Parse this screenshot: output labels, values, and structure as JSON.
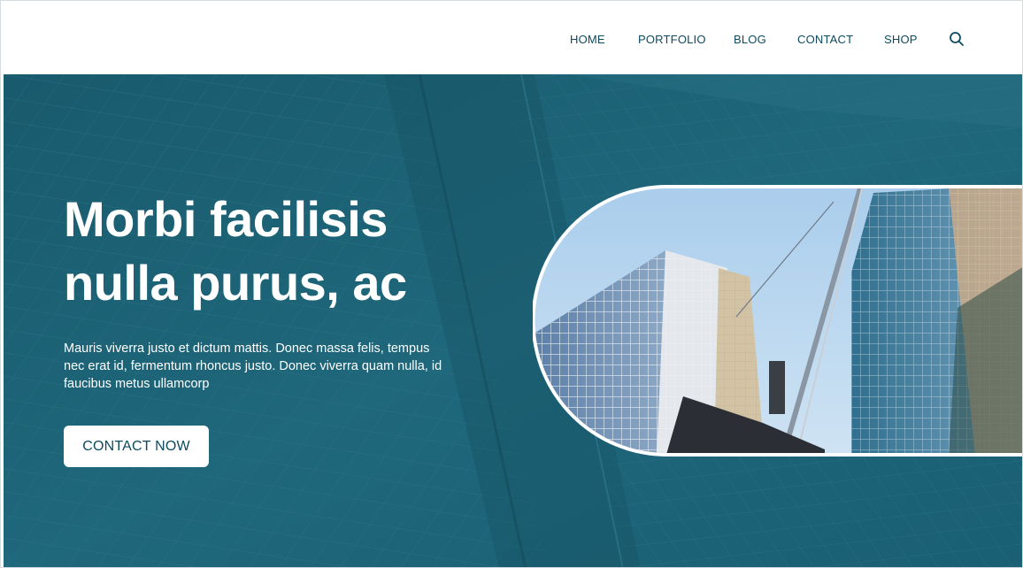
{
  "nav": {
    "items": [
      {
        "label": "HOME"
      },
      {
        "label": "PORTFOLIO"
      },
      {
        "label": "BLOG"
      },
      {
        "label": "CONTACT"
      },
      {
        "label": "SHOP"
      }
    ],
    "search_icon": "search-icon"
  },
  "hero": {
    "title": "Morbi facilisis nulla purus, ac",
    "text": "Mauris viverra justo et dictum mattis. Donec massa felis, tempus nec erat id, fermentum rhoncus justo. Donec viverra quam nulla, id faucibus metus ullamcorp",
    "cta_label": "CONTACT NOW"
  },
  "colors": {
    "brand_teal": "#1e6478",
    "nav_text": "#0e4a5e",
    "button_bg": "#ffffff"
  }
}
